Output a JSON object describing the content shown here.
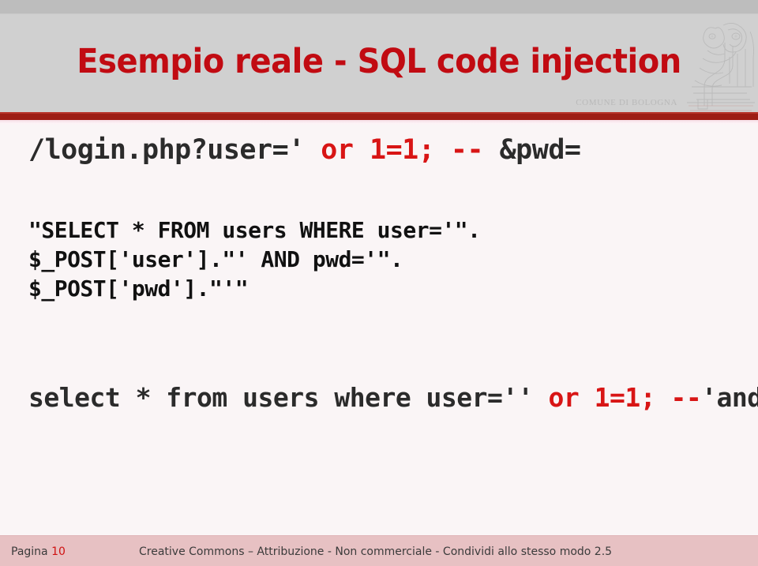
{
  "header": {
    "title": "Esempio reale - SQL code injection",
    "logo_caption": "COMUNE DI BOLOGNA",
    "logo_icon": "comune-di-bologna-crest",
    "title_color": "#c10b12",
    "background_color": "#d0d0d0",
    "rule_color": "#9d1d14"
  },
  "content": {
    "url_line": {
      "prefix": "/login.php?user='",
      "injection": " or 1=1; --",
      "suffix": " &pwd="
    },
    "php_snippet": {
      "line1": "\"SELECT * FROM users WHERE user='\".",
      "line2": "$_POST['user'].\"' AND pwd='\".",
      "line3": "$_POST['pwd'].\"'\""
    },
    "sql_result": {
      "prefix": "select * from users where user=''",
      "injection": " or 1=1; --",
      "suffix": "'and pwd=''"
    },
    "injection_color": "#d81515",
    "code_color": "#2b2b2b"
  },
  "footer": {
    "page_label": "Pagina",
    "page_number": "10",
    "license": "Creative Commons – Attribuzione - Non commerciale - Condividi allo stesso modo 2.5",
    "background_color": "#e7c1c3",
    "page_number_color": "#cf1111"
  }
}
